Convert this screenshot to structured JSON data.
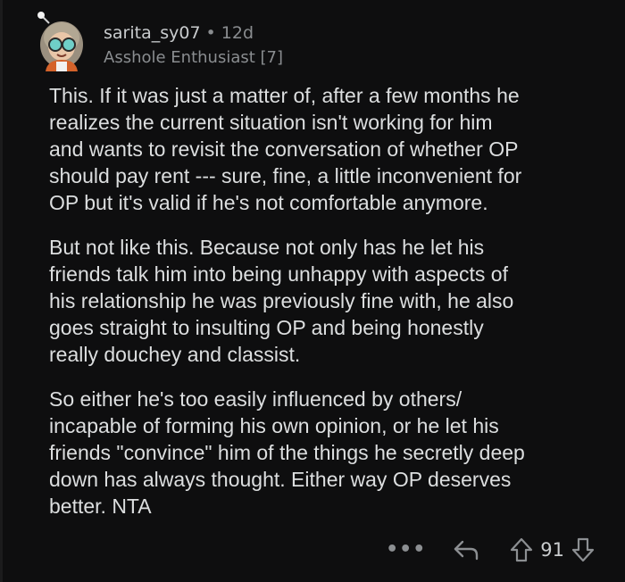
{
  "comment": {
    "username": "sarita_sy07",
    "separator": "•",
    "age": "12d",
    "flair": "Asshole Enthusiast [7]",
    "paragraphs": [
      "This. If it was just a matter of, after a few months he\nrealizes the current situation isn't working for him\nand wants to revisit the conversation of whether OP\nshould pay rent --- sure, fine, a little inconvenient for\nOP but it's valid if he's not comfortable anymore.",
      "But not like this. Because not only has he let his\nfriends talk him into being unhappy with aspects of\nhis relationship he was previously fine with, he also\ngoes straight to insulting OP and being honestly\nreally douchey and classist.",
      "So either he's too easily influenced by others/\nincapable of forming his own opinion, or he let his\nfriends \"convince\" him of the things he secretly deep\ndown has always thought. Either way OP deserves\nbetter. NTA"
    ],
    "score": "91"
  },
  "actions": {
    "more_label": "•••",
    "icons": [
      "more-icon",
      "reply-icon",
      "upvote-icon",
      "downvote-icon"
    ]
  },
  "colors": {
    "background": "#0e0e0f",
    "text": "#dcdedf",
    "muted": "#8a8d90"
  }
}
